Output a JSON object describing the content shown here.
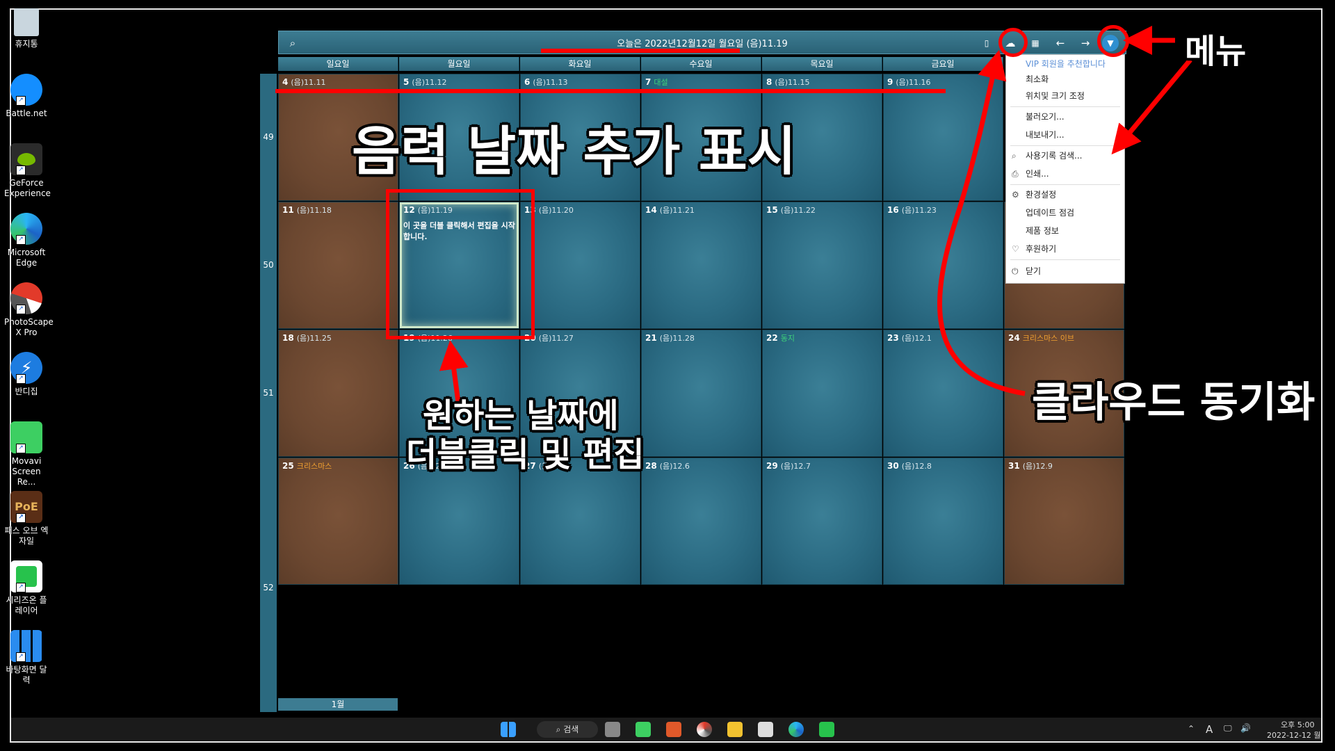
{
  "desktop": {
    "icons": [
      {
        "label": "휴지통",
        "icon": "recycle-bin-icon"
      },
      {
        "label": "Battle.net",
        "icon": "battlenet-icon"
      },
      {
        "label": "GeForce Experience",
        "icon": "geforce-icon"
      },
      {
        "label": "Microsoft Edge",
        "icon": "edge-icon"
      },
      {
        "label": "PhotoScape X Pro",
        "icon": "photoscape-icon"
      },
      {
        "label": "반디집",
        "icon": "bandizip-icon"
      },
      {
        "label": "Movavi Screen Re...",
        "icon": "movavi-icon"
      },
      {
        "label": "패스 오브 엑자일",
        "icon": "poe-icon"
      },
      {
        "label": "시리즈온 플레이어",
        "icon": "serieson-icon"
      },
      {
        "label": "바탕화면 달력",
        "icon": "desktop-calendar-icon"
      }
    ]
  },
  "app": {
    "title": "오늘은 2022년12월12일 월요일 (음)11.19",
    "weekdays": [
      "일요일",
      "월요일",
      "화요일",
      "수요일",
      "목요일",
      "금요일"
    ],
    "week_numbers": [
      "49",
      "50",
      "51",
      "52"
    ],
    "month_tab": "1월",
    "weeks": [
      [
        {
          "day": "4",
          "lunar": "(음)11.11",
          "event": ""
        },
        {
          "day": "5",
          "lunar": "(음)11.12",
          "event": ""
        },
        {
          "day": "6",
          "lunar": "(음)11.13",
          "event": ""
        },
        {
          "day": "7",
          "lunar": "",
          "event": "대설"
        },
        {
          "day": "8",
          "lunar": "(음)11.15",
          "event": ""
        },
        {
          "day": "9",
          "lunar": "(음)11.16",
          "event": ""
        }
      ],
      [
        {
          "day": "11",
          "lunar": "(음)11.18",
          "event": ""
        },
        {
          "day": "12",
          "lunar": "(음)11.19",
          "event": "",
          "note": "이 곳을 더블 클릭해서 편집을 시작합니다."
        },
        {
          "day": "13",
          "lunar": "(음)11.20",
          "event": ""
        },
        {
          "day": "14",
          "lunar": "(음)11.21",
          "event": ""
        },
        {
          "day": "15",
          "lunar": "(음)11.22",
          "event": ""
        },
        {
          "day": "16",
          "lunar": "(음)11.23",
          "event": ""
        }
      ],
      [
        {
          "day": "18",
          "lunar": "(음)11.25",
          "event": ""
        },
        {
          "day": "19",
          "lunar": "(음)11.26",
          "event": ""
        },
        {
          "day": "20",
          "lunar": "(음)11.27",
          "event": ""
        },
        {
          "day": "21",
          "lunar": "(음)11.28",
          "event": ""
        },
        {
          "day": "22",
          "lunar": "",
          "event": "동지"
        },
        {
          "day": "23",
          "lunar": "(음)12.1",
          "event": ""
        }
      ],
      [
        {
          "day": "25",
          "lunar": "",
          "event": "크리스마스"
        },
        {
          "day": "26",
          "lunar": "(음)12.4",
          "event": ""
        },
        {
          "day": "27",
          "lunar": "(음)12.5",
          "event": ""
        },
        {
          "day": "28",
          "lunar": "(음)12.6",
          "event": ""
        },
        {
          "day": "29",
          "lunar": "(음)12.7",
          "event": ""
        },
        {
          "day": "30",
          "lunar": "(음)12.8",
          "event": ""
        }
      ]
    ],
    "saturday_cells": [
      {
        "day": "24",
        "lunar": "",
        "event": "크리스마스 이브"
      },
      {
        "day": "31",
        "lunar": "(음)12.9",
        "event": ""
      }
    ],
    "menu": {
      "items": [
        {
          "label": "VIP 회원을 추천합니다",
          "icon": ""
        },
        {
          "label": "최소화",
          "icon": ""
        },
        {
          "label": "위치및 크기 조정",
          "icon": ""
        },
        {
          "label": "불러오기...",
          "icon": ""
        },
        {
          "label": "내보내기...",
          "icon": ""
        },
        {
          "label": "사용기록 검색...",
          "icon": "search-icon"
        },
        {
          "label": "인쇄...",
          "icon": "printer-icon"
        },
        {
          "label": "환경설정",
          "icon": "gear-icon"
        },
        {
          "label": "업데이트 점검",
          "icon": ""
        },
        {
          "label": "제품 정보",
          "icon": ""
        },
        {
          "label": "후원하기",
          "icon": "heart-icon"
        },
        {
          "label": "닫기",
          "icon": "power-icon"
        }
      ]
    }
  },
  "annotations": {
    "lunar": "음력 날짜 추가 표시",
    "edit_line1": "원하는 날짜에",
    "edit_line2": "더블클릭 및 편집",
    "menu": "메뉴",
    "cloud": "클라우드 동기화"
  },
  "taskbar": {
    "search_label": "검색",
    "time": "오후 5:00",
    "date": "2022-12-12 월",
    "ime": "A"
  },
  "colors": {
    "teal": "#2b6b83",
    "brown": "#6b4730",
    "holiday_text": "#f0a030",
    "solar_term_text": "#3dd17a",
    "annotation_red": "#ff0000"
  }
}
